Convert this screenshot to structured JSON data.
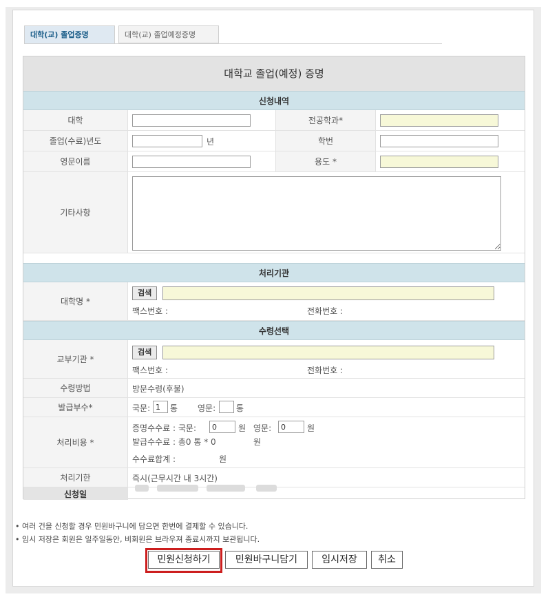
{
  "tabs": [
    {
      "label": "대학(교) 졸업증명",
      "active": true
    },
    {
      "label": "대학(교) 졸업예정증명",
      "active": false
    }
  ],
  "form": {
    "title": "대학교 졸업(예정) 증명",
    "sections": {
      "apply": "신청내역",
      "agency": "처리기관",
      "receive": "수령선택"
    },
    "labels": {
      "university": "대학",
      "major": "전공학과*",
      "grad_year": "졸업(수료)년도",
      "student_no": "학번",
      "english_name": "영문이름",
      "purpose": "용도 *",
      "etc": "기타사항",
      "univ_name": "대학명 *",
      "issuing_agency": "교부기관 *",
      "receive_method": "수령방법",
      "copies": "발급부수*",
      "fee": "처리비용 *",
      "deadline": "처리기한",
      "apply_date": "신청일"
    },
    "values": {
      "year_suffix": "년",
      "search_button": "검색",
      "fax_label": "팩스번호 :",
      "phone_label": "전화번호 :",
      "receive_method_value": "방문수령(후불)",
      "copies_korean_label": "국문:",
      "copies_korean_value": "1",
      "copies_unit": "통",
      "copies_english_label": "영문:",
      "copies_english_value": "",
      "fee_cert_label": "증명수수료 : 국문:",
      "fee_korean_value": "0",
      "won": "원",
      "fee_english_label": "영문:",
      "fee_english_value": "0",
      "fee_issue_text": "발급수수료 : 총0 통 * 0",
      "fee_total_label": "수수료합계 :",
      "deadline_value": "즉시(근무시간 내 3시간)"
    }
  },
  "notes": [
    "• 여러 건을 신청할 경우 민원바구니에 담으면 한번에 결제할 수 있습니다.",
    "• 임시 저장은 회원은 일주일동안, 비회원은 브라우져 종료시까지 보관됩니다."
  ],
  "buttons": {
    "apply": "민원신청하기",
    "basket": "민원바구니담기",
    "temp_save": "임시저장",
    "cancel": "취소"
  },
  "colors": {
    "section_header": "#cfe3ea",
    "required_field": "#f7f8d8",
    "highlight": "#cc1e1e"
  }
}
